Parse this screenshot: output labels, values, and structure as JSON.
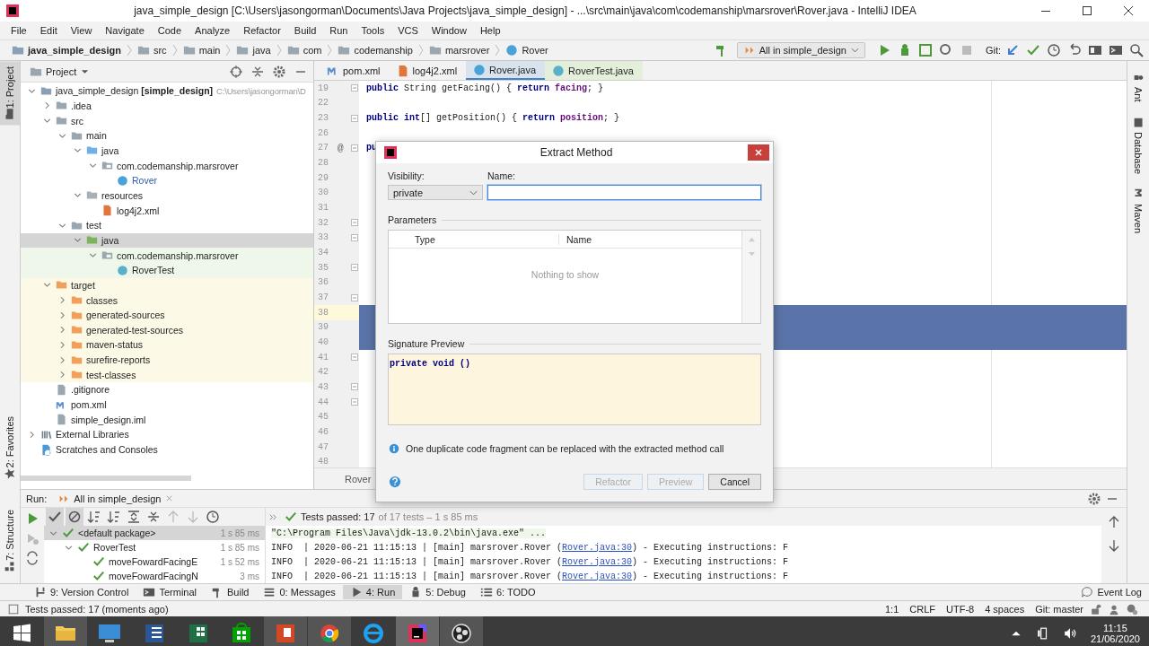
{
  "window": {
    "title": "java_simple_design [C:\\Users\\jasongorman\\Documents\\Java Projects\\java_simple_design] - ...\\src\\main\\java\\com\\codemanship\\marsrover\\Rover.java - IntelliJ IDEA"
  },
  "menu": [
    "File",
    "Edit",
    "View",
    "Navigate",
    "Code",
    "Analyze",
    "Refactor",
    "Build",
    "Run",
    "Tools",
    "VCS",
    "Window",
    "Help"
  ],
  "breadcrumbs": [
    {
      "label": "java_simple_design",
      "kind": "module"
    },
    {
      "label": "src",
      "kind": "folder"
    },
    {
      "label": "main",
      "kind": "folder"
    },
    {
      "label": "java",
      "kind": "folder"
    },
    {
      "label": "com",
      "kind": "folder"
    },
    {
      "label": "codemanship",
      "kind": "folder"
    },
    {
      "label": "marsrover",
      "kind": "folder"
    },
    {
      "label": "Rover",
      "kind": "class"
    }
  ],
  "toolbar": {
    "run_configuration": "All in simple_design",
    "vcs_label": "Git:"
  },
  "side_tabs": {
    "left_top": [
      {
        "label": "1: Project",
        "kind": "folder",
        "selected": true
      }
    ],
    "left_bottom": [
      {
        "label": "2: Favorites",
        "kind": "star",
        "selected": false
      },
      {
        "label": "7: Structure",
        "kind": "structure",
        "selected": false
      }
    ],
    "right": [
      {
        "label": "Ant",
        "kind": "ant",
        "selected": false
      },
      {
        "label": "Database",
        "kind": "database",
        "selected": false
      },
      {
        "label": "Maven",
        "kind": "maven",
        "selected": false
      }
    ]
  },
  "project": {
    "title": "Project",
    "tree": [
      {
        "label": "java_simple_design **[simple_design]**",
        "path": "C:\\Users\\jasongorman\\D",
        "kind": "module",
        "expanded": true,
        "selected": false,
        "children": [
          {
            "label": ".idea",
            "kind": "folder",
            "expanded": false,
            "selected": false
          },
          {
            "label": "src",
            "kind": "folder",
            "expanded": true,
            "selected": false,
            "children": [
              {
                "label": "main",
                "kind": "folder",
                "expanded": true,
                "selected": false,
                "children": [
                  {
                    "label": "java",
                    "kind": "source",
                    "expanded": true,
                    "selected": false,
                    "children": [
                      {
                        "label": "com.codemanship.marsrover",
                        "kind": "package",
                        "expanded": true,
                        "selected": false,
                        "children": [
                          {
                            "label": "Rover",
                            "kind": "class",
                            "selected": false,
                            "modified": true
                          }
                        ]
                      }
                    ]
                  },
                  {
                    "label": "resources",
                    "kind": "resources",
                    "expanded": true,
                    "selected": false,
                    "children": [
                      {
                        "label": "log4j2.xml",
                        "kind": "xml",
                        "selected": false
                      }
                    ]
                  }
                ]
              },
              {
                "label": "test",
                "kind": "folder",
                "expanded": true,
                "selected": false,
                "children": [
                  {
                    "label": "java",
                    "kind": "test-source",
                    "expanded": true,
                    "selected": true,
                    "children": [
                      {
                        "label": "com.codemanship.marsrover",
                        "kind": "test-package",
                        "expanded": true,
                        "selected": false,
                        "children": [
                          {
                            "label": "RoverTest",
                            "kind": "test-class",
                            "selected": false
                          }
                        ]
                      }
                    ]
                  }
                ]
              }
            ]
          },
          {
            "label": "target",
            "kind": "excluded",
            "expanded": true,
            "selected": false,
            "children": [
              {
                "label": "classes",
                "kind": "excluded",
                "expanded": false,
                "selected": false
              },
              {
                "label": "generated-sources",
                "kind": "excluded",
                "expanded": false,
                "selected": false
              },
              {
                "label": "generated-test-sources",
                "kind": "excluded",
                "expanded": false,
                "selected": false
              },
              {
                "label": "maven-status",
                "kind": "excluded",
                "expanded": false,
                "selected": false
              },
              {
                "label": "surefire-reports",
                "kind": "excluded",
                "expanded": false,
                "selected": false
              },
              {
                "label": "test-classes",
                "kind": "excluded",
                "expanded": false,
                "selected": false
              }
            ]
          },
          {
            "label": ".gitignore",
            "kind": "file",
            "selected": false
          },
          {
            "label": "pom.xml",
            "kind": "maven",
            "selected": false
          },
          {
            "label": "simple_design.iml",
            "kind": "file",
            "selected": false
          }
        ]
      },
      {
        "label": "External Libraries",
        "kind": "libraries",
        "expanded": false,
        "selected": false
      },
      {
        "label": "Scratches and Consoles",
        "kind": "scratches",
        "selected": false
      }
    ]
  },
  "editor": {
    "tabs": [
      {
        "label": "pom.xml",
        "kind": "maven",
        "selected": false
      },
      {
        "label": "log4j2.xml",
        "kind": "xml",
        "selected": false
      },
      {
        "label": "Rover.java",
        "kind": "class",
        "selected": true
      },
      {
        "label": "RoverTest.java",
        "kind": "test-class",
        "selected": false
      }
    ],
    "lines": [
      {
        "number": "19",
        "fold": true,
        "selected": false,
        "code": [
          {
            "text": "public",
            "kind": "keyword"
          },
          {
            "text": " String getFacing() { "
          },
          {
            "text": "return ",
            "kind": "keyword"
          },
          {
            "text": "facing",
            "kind": "field"
          },
          {
            "text": "; }"
          }
        ]
      },
      {
        "number": "22",
        "fold": false,
        "selected": false
      },
      {
        "number": "23",
        "fold": true,
        "selected": false,
        "code": [
          {
            "text": "public int",
            "kind": "keyword"
          },
          {
            "text": "[] getPosition() { "
          },
          {
            "text": "return ",
            "kind": "keyword"
          },
          {
            "text": "position",
            "kind": "field"
          },
          {
            "text": "; }"
          }
        ]
      },
      {
        "number": "26",
        "fold": false,
        "selected": false
      },
      {
        "number": "27",
        "fold": true,
        "selected": false,
        "marker": "@",
        "code": [
          {
            "text": "pu",
            "kind": "keyword"
          }
        ]
      },
      {
        "number": "28",
        "fold": false,
        "selected": false
      },
      {
        "number": "29",
        "fold": false,
        "selected": false
      },
      {
        "number": "30",
        "fold": false,
        "selected": false
      },
      {
        "number": "31",
        "fold": false,
        "selected": false
      },
      {
        "number": "32",
        "fold": true,
        "selected": false
      },
      {
        "number": "33",
        "fold": true,
        "selected": false
      },
      {
        "number": "34",
        "fold": false,
        "selected": false
      },
      {
        "number": "35",
        "fold": true,
        "selected": false
      },
      {
        "number": "36",
        "fold": false,
        "selected": false
      },
      {
        "number": "37",
        "fold": true,
        "selected": false
      },
      {
        "number": "38",
        "fold": false,
        "selected": true,
        "current": true
      },
      {
        "number": "39",
        "fold": false,
        "selected": true
      },
      {
        "number": "40",
        "fold": false,
        "selected": true
      },
      {
        "number": "41",
        "fold": true,
        "selected": false
      },
      {
        "number": "42",
        "fold": false,
        "selected": false
      },
      {
        "number": "43",
        "fold": true,
        "selected": false
      },
      {
        "number": "44",
        "fold": true,
        "selected": false
      },
      {
        "number": "45",
        "fold": false,
        "selected": false
      },
      {
        "number": "46",
        "fold": false,
        "selected": false
      },
      {
        "number": "47",
        "fold": false,
        "selected": false
      },
      {
        "number": "48",
        "fold": false,
        "selected": false
      }
    ],
    "breadcrumb": "Rover"
  },
  "dialog": {
    "title": "Extract Method",
    "visibility_label": "Visibility:",
    "visibility": "private",
    "name_label": "Name:",
    "name_focused": true,
    "parameters_title": "Parameters",
    "columns": [
      "Type",
      "Name"
    ],
    "empty_text": "Nothing to show",
    "signature_title": "Signature Preview",
    "signature": "private void ()",
    "info": "One duplicate code fragment can be replaced with the extracted method call",
    "buttons": [
      {
        "label": "Refactor",
        "disabled": true
      },
      {
        "label": "Preview",
        "disabled": true
      },
      {
        "label": "Cancel",
        "disabled": false
      }
    ]
  },
  "run": {
    "label": "Run:",
    "tab": "All in simple_design",
    "status": "Tests passed: 17",
    "status_detail": "of 17 tests – 1 s 85 ms",
    "tests": [
      {
        "label": "<default package>",
        "time": "1 s 85 ms",
        "expanded": true,
        "selected": true,
        "children": [
          {
            "label": "RoverTest",
            "time": "1 s 85 ms",
            "expanded": true,
            "selected": false,
            "children": [
              {
                "label": "moveFowardFacingE",
                "time": "1 s 52 ms",
                "selected": false
              },
              {
                "label": "moveFowardFacingN",
                "time": "3 ms",
                "selected": false
              }
            ]
          }
        ]
      }
    ],
    "console": [
      {
        "kind": "command",
        "text": "\"C:\\Program Files\\Java\\jdk-13.0.2\\bin\\java.exe\" ..."
      },
      {
        "kind": "log",
        "before": "INFO  | 2020-06-21 11:15:13 | [main] marsrover.Rover (",
        "link": "Rover.java:30",
        "after": ") - Executing instructions: F"
      },
      {
        "kind": "log",
        "before": "INFO  | 2020-06-21 11:15:13 | [main] marsrover.Rover (",
        "link": "Rover.java:30",
        "after": ") - Executing instructions: F"
      },
      {
        "kind": "log",
        "before": "INFO  | 2020-06-21 11:15:13 | [main] marsrover.Rover (",
        "link": "Rover.java:30",
        "after": ") - Executing instructions: F"
      }
    ]
  },
  "tool_windows": [
    {
      "label": "9: Version Control",
      "kind": "vcs",
      "selected": false
    },
    {
      "label": "Terminal",
      "kind": "terminal",
      "selected": false
    },
    {
      "label": "Build",
      "kind": "build",
      "selected": false
    },
    {
      "label": "0: Messages",
      "kind": "messages",
      "selected": false
    },
    {
      "label": "4: Run",
      "kind": "run",
      "selected": true
    },
    {
      "label": "5: Debug",
      "kind": "debug",
      "selected": false
    },
    {
      "label": "6: TODO",
      "kind": "todo",
      "selected": false
    }
  ],
  "event_log": "Event Log",
  "status": {
    "message": "Tests passed: 17 (moments ago)",
    "items": [
      "1:1",
      "CRLF",
      "UTF-8",
      "4 spaces",
      "Git: master"
    ]
  },
  "clock": {
    "time": "11:15",
    "date": "21/06/2020"
  }
}
